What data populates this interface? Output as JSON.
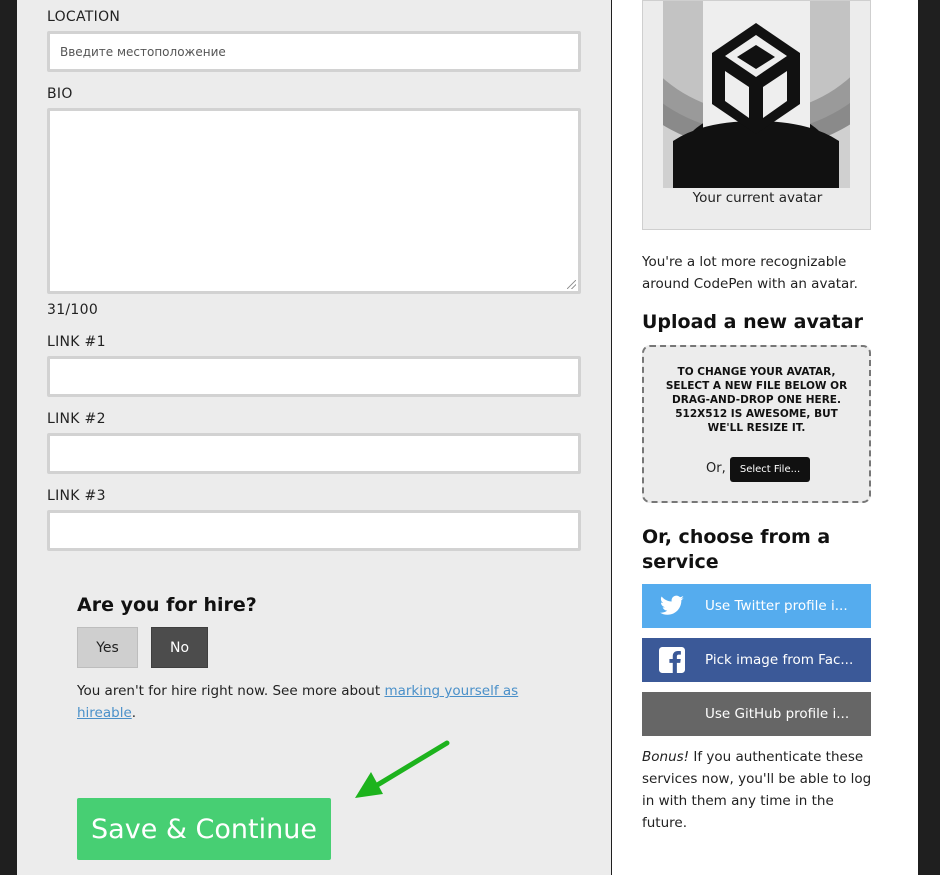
{
  "form": {
    "location": {
      "label": "LOCATION",
      "placeholder": "Введите местоположение",
      "value": ""
    },
    "bio": {
      "label": "BIO",
      "value": "",
      "counter": "31/100"
    },
    "link1": {
      "label": "LINK #1",
      "value": ""
    },
    "link2": {
      "label": "LINK #2",
      "value": ""
    },
    "link3": {
      "label": "LINK #3",
      "value": ""
    }
  },
  "hire": {
    "title": "Are you for hire?",
    "yes_label": "Yes",
    "no_label": "No",
    "status_text": "You aren't for hire right now. See more about ",
    "link_text": "marking yourself as hireable",
    "period": "."
  },
  "save_label": "Save & Continue",
  "sidebar": {
    "avatar_caption": "Your current avatar",
    "recognize_text": "You're a lot more recognizable around CodePen with an avatar.",
    "upload_title": "Upload a new avatar",
    "drop_text": "TO CHANGE YOUR AVATAR, SELECT A NEW FILE BELOW OR DRAG-AND-DROP ONE HERE. 512X512 IS AWESOME, BUT WE'LL RESIZE IT.",
    "or_label": "Or,",
    "select_file_label": "Select File...",
    "service_title": "Or, choose from a service",
    "services": [
      {
        "label": "Use Twitter profile i...",
        "icon": "twitter-icon",
        "color": "#55acee"
      },
      {
        "label": "Pick image from Fac...",
        "icon": "facebook-icon",
        "color": "#3b5998"
      },
      {
        "label": "Use GitHub profile i...",
        "icon": "",
        "color": "#666666"
      }
    ],
    "bonus_em": "Bonus!",
    "bonus_text": " If you authenticate these services now, you'll be able to log in with them any time in the future."
  },
  "colors": {
    "accent_green": "#47cf73",
    "link_blue": "#4a90c9",
    "arrow_green": "#1db31d"
  }
}
